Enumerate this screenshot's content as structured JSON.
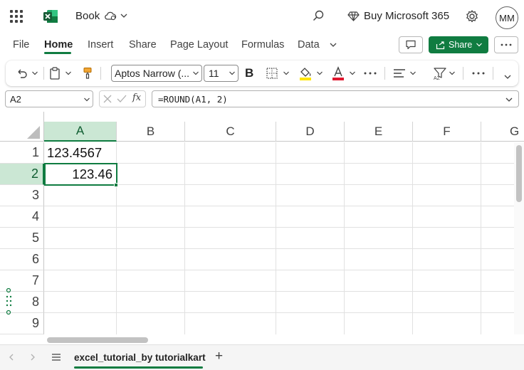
{
  "app": {
    "title": "Book",
    "buy_label": "Buy Microsoft 365",
    "avatar_initials": "MM",
    "brand_color": "#107c41"
  },
  "menu": {
    "tabs": [
      "File",
      "Home",
      "Insert",
      "Share",
      "Page Layout",
      "Formulas",
      "Data"
    ],
    "active_tab": "Home",
    "share_label": "Share"
  },
  "ribbon": {
    "font_name": "Aptos Narrow (...",
    "font_size": "11",
    "bold_label": "B",
    "icons": [
      "undo-icon",
      "paste-icon",
      "format-painter-icon",
      "borders-icon",
      "fill-color-icon",
      "font-color-icon",
      "more-icon",
      "align-icon",
      "sort-filter-icon",
      "more-icon",
      "collapse-ribbon-icon"
    ]
  },
  "formula_bar": {
    "name_box": "A2",
    "fx_label": "fx",
    "formula": "=ROUND(A1, 2)"
  },
  "grid": {
    "columns": [
      "A",
      "B",
      "C",
      "D",
      "E",
      "F",
      "G"
    ],
    "rows": [
      "1",
      "2",
      "3",
      "4",
      "5",
      "6",
      "7",
      "8",
      "9"
    ],
    "selected_column": "A",
    "selected_row": "2",
    "cells": {
      "A1": "123.4567",
      "A2": "123.46"
    }
  },
  "sheets": {
    "tabs": [
      "excel_tutorial_by tutorialkart"
    ],
    "add_label": "+"
  }
}
